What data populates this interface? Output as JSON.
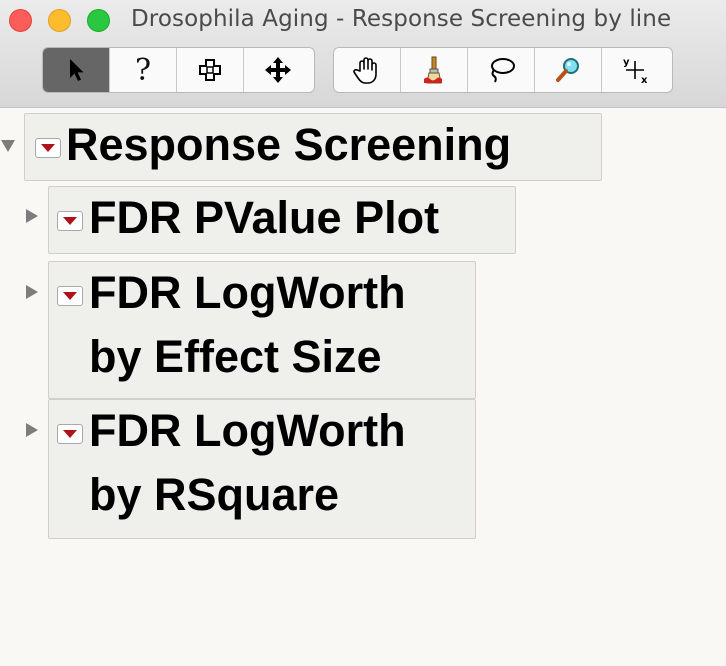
{
  "window": {
    "title": "Drosophila Aging - Response Screening by line"
  },
  "toolbar": {
    "group1": [
      {
        "icon": "arrow-pointer-icon",
        "glyph": "➤"
      },
      {
        "icon": "help-question-icon",
        "glyph": "?"
      },
      {
        "icon": "crosshair-select-icon",
        "glyph": "✚"
      },
      {
        "icon": "move-arrows-icon",
        "glyph": "✥"
      }
    ],
    "group2": [
      {
        "icon": "hand-grabber-icon",
        "glyph": "✋"
      },
      {
        "icon": "brush-icon",
        "glyph": "🖌"
      },
      {
        "icon": "lasso-icon",
        "glyph": "➰"
      },
      {
        "icon": "magnifier-icon",
        "glyph": "🔎"
      },
      {
        "icon": "crosshair-xy-icon",
        "glyph": "┼"
      }
    ]
  },
  "report": {
    "title": "Response Screening",
    "children": [
      {
        "title": "FDR PValue Plot"
      },
      {
        "title": "FDR LogWorth",
        "title_line2": "by Effect Size"
      },
      {
        "title": "FDR LogWorth",
        "title_line2": "by RSquare"
      }
    ]
  }
}
